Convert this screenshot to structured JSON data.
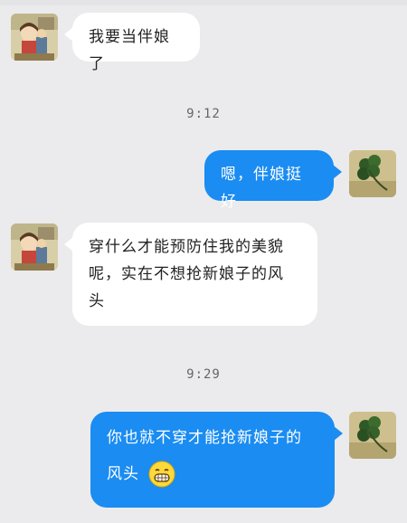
{
  "messages": [
    {
      "side": "left",
      "text": "我要当伴娘了"
    },
    {
      "time": "9:12"
    },
    {
      "side": "right",
      "text": "嗯，伴娘挺好"
    },
    {
      "side": "left",
      "line1": "穿什么才能预防住我的美貌",
      "line2": "呢，实在不想抢新娘子的风",
      "line3": "头"
    },
    {
      "time": "9:29"
    },
    {
      "side": "right",
      "line1": "你也就不穿才能抢新娘子的",
      "line2": "风头",
      "emoji": "grinning-face-emoji"
    }
  ],
  "colors": {
    "background": "#ebebed",
    "incoming_bubble": "#ffffff",
    "outgoing_bubble": "#1a8cf2"
  },
  "avatars": {
    "friend": "cartoon-girl-avatar",
    "me": "clover-avatar"
  }
}
